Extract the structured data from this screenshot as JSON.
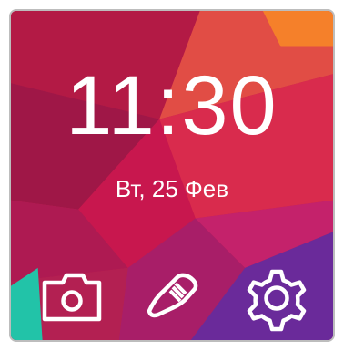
{
  "lockscreen": {
    "time": "11:30",
    "date": "Вт, 25 Фев"
  },
  "shortcuts": [
    {
      "icon": "camera-icon"
    },
    {
      "icon": "running-shoe-icon"
    },
    {
      "icon": "gear-icon"
    }
  ],
  "colors": {
    "primary_text": "#ffffff",
    "accent": "#d92b4d",
    "accent_orange": "#f36b2a",
    "accent_purple": "#6a2a9a",
    "accent_teal": "#22c3a8",
    "frame": "#bdbdbd"
  }
}
